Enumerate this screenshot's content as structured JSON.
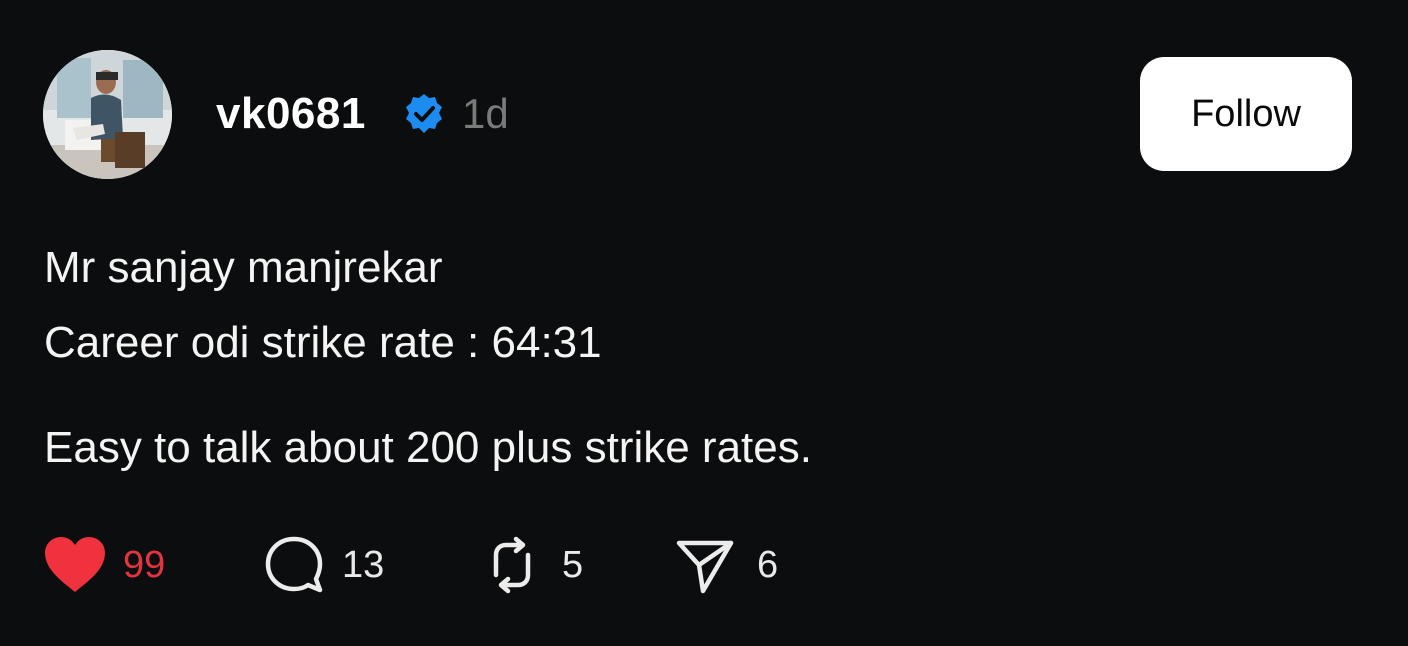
{
  "post": {
    "username": "vk0681",
    "verified": true,
    "time": "1d",
    "follow_label": "Follow",
    "lines": [
      "Mr sanjay manjrekar",
      "Career odi strike rate : 64:31",
      "Easy to talk about 200 plus strike rates."
    ],
    "actions": {
      "likes": "99",
      "replies": "13",
      "reposts": "5",
      "shares": "6"
    }
  },
  "icons": {
    "verified": "verified-badge-icon",
    "like": "heart-icon",
    "reply": "comment-bubble-icon",
    "repost": "repost-icon",
    "share": "send-icon"
  },
  "colors": {
    "background": "#0c0d0e",
    "text": "#f3f3f3",
    "muted": "#7b7b7b",
    "like_red": "#e0353f",
    "verified_blue": "#1d8cf0",
    "follow_bg": "#ffffff"
  }
}
